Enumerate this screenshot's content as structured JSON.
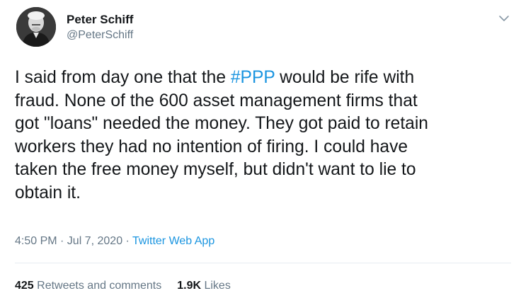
{
  "author": {
    "display_name": "Peter Schiff",
    "handle": "@PeterSchiff"
  },
  "tweet": {
    "text_before": "I said from day one that the ",
    "hashtag": "#PPP",
    "text_after": " would be rife with\nfraud. None of the 600 asset management firms that\ngot \"loans\" needed the money. They got paid to retain\nworkers they had no intention of firing. I could have\ntaken the free money myself, but didn't want to lie to\nobtain it."
  },
  "meta": {
    "timestamp": "4:50 PM · Jul 7, 2020 · ",
    "source": "Twitter Web App"
  },
  "stats": {
    "retweets_count": "425",
    "retweets_label": " Retweets and comments",
    "likes_count": "1.9K",
    "likes_label": " Likes"
  },
  "colors": {
    "link": "#1b95e0",
    "secondary_text": "#657786",
    "primary_text": "#14171a",
    "divider": "#e6ecf0"
  },
  "icons": {
    "caret": "chevron-down-icon",
    "avatar": "profile-photo"
  }
}
